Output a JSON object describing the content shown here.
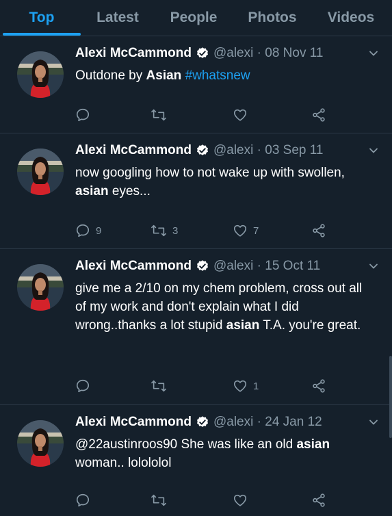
{
  "tabs": [
    "Top",
    "Latest",
    "People",
    "Photos",
    "Videos"
  ],
  "active_tab": "Top",
  "colors": {
    "accent": "#1da1f2",
    "background": "#15202b",
    "muted": "#8899a6"
  },
  "tweets": [
    {
      "name": "Alexi McCammond",
      "handle": "@alexi",
      "date": "08 Nov 11",
      "segments": [
        {
          "text": "Outdone by ",
          "style": "normal"
        },
        {
          "text": "Asian",
          "style": "bold"
        },
        {
          "text": " ",
          "style": "normal"
        },
        {
          "text": "#whatsnew",
          "style": "hashtag"
        }
      ],
      "replies": "",
      "retweets": "",
      "likes": ""
    },
    {
      "name": "Alexi McCammond",
      "handle": "@alexi",
      "date": "03 Sep 11",
      "segments": [
        {
          "text": "now googling how to not wake up with swollen, ",
          "style": "normal"
        },
        {
          "text": "asian",
          "style": "bold"
        },
        {
          "text": " eyes...",
          "style": "normal"
        }
      ],
      "replies": "9",
      "retweets": "3",
      "likes": "7"
    },
    {
      "name": "Alexi McCammond",
      "handle": "@alexi",
      "date": "15 Oct 11",
      "segments": [
        {
          "text": "give me a 2/10 on my chem problem, cross out all of my work and don't explain what I did wrong..thanks a lot stupid ",
          "style": "normal"
        },
        {
          "text": "asian",
          "style": "bold"
        },
        {
          "text": " T.A. you're great.",
          "style": "normal"
        }
      ],
      "replies": "",
      "retweets": "",
      "likes": "1"
    },
    {
      "name": "Alexi McCammond",
      "handle": "@alexi",
      "date": "24 Jan 12",
      "segments": [
        {
          "text": "@22austinroos90 She was like an old ",
          "style": "normal"
        },
        {
          "text": "asian",
          "style": "bold"
        },
        {
          "text": " woman.. lolololol",
          "style": "normal"
        }
      ],
      "replies": "",
      "retweets": "",
      "likes": ""
    }
  ]
}
